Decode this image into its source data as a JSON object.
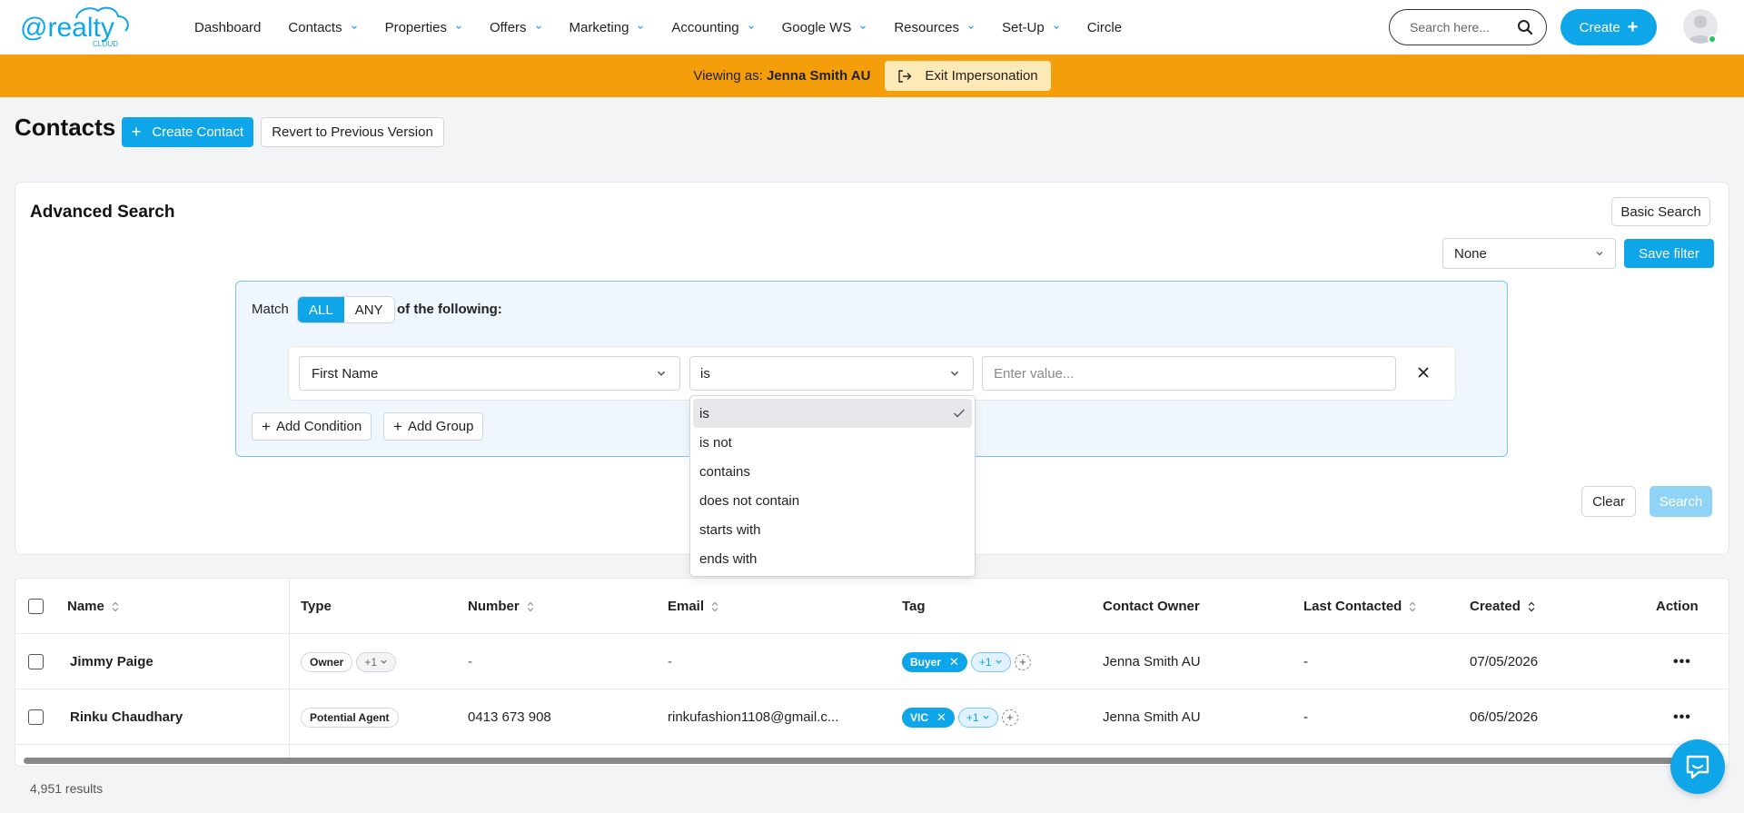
{
  "logo": {
    "brand_text": "@realty",
    "sub_text": "CLOUD"
  },
  "nav": {
    "items": [
      {
        "label": "Dashboard",
        "dropdown": false
      },
      {
        "label": "Contacts",
        "dropdown": true
      },
      {
        "label": "Properties",
        "dropdown": true
      },
      {
        "label": "Offers",
        "dropdown": true
      },
      {
        "label": "Marketing",
        "dropdown": true
      },
      {
        "label": "Accounting",
        "dropdown": true
      },
      {
        "label": "Google WS",
        "dropdown": true
      },
      {
        "label": "Resources",
        "dropdown": true
      },
      {
        "label": "Set-Up",
        "dropdown": true
      },
      {
        "label": "Circle",
        "dropdown": false
      }
    ],
    "search_placeholder": "Search here...",
    "create_label": "Create"
  },
  "impersonation": {
    "prefix": "Viewing as:",
    "user": "Jenna Smith AU",
    "exit_label": "Exit Impersonation"
  },
  "page": {
    "title": "Contacts",
    "create_contact_label": "Create Contact",
    "revert_label": "Revert to Previous Version"
  },
  "advanced_search": {
    "title": "Advanced Search",
    "basic_search_label": "Basic Search",
    "saved_filter_value": "None",
    "save_filter_label": "Save filter",
    "match_label": "Match",
    "match_options": [
      "ALL",
      "ANY"
    ],
    "match_selected": "ALL",
    "of_following": "of the following:",
    "condition": {
      "field": "First Name",
      "operator": "is",
      "value_placeholder": "Enter value..."
    },
    "add_condition_label": "Add Condition",
    "add_group_label": "Add Group",
    "clear_label": "Clear",
    "search_label": "Search",
    "operator_options": [
      "is",
      "is not",
      "contains",
      "does not contain",
      "starts with",
      "ends with"
    ]
  },
  "table": {
    "columns": [
      "Name",
      "Type",
      "Number",
      "Email",
      "Tag",
      "Contact Owner",
      "Last Contacted",
      "Created",
      "Action"
    ],
    "rows": [
      {
        "name": "Jimmy Paige",
        "type": "Owner",
        "type_more": "+1",
        "number": "-",
        "email": "-",
        "tag": "Buyer",
        "tag_more": "+1",
        "owner": "Jenna Smith AU",
        "last_contacted": "-",
        "created": "07/05/2026",
        "action": "•••"
      },
      {
        "name": "Rinku Chaudhary",
        "type": "Potential Agent",
        "type_more": "",
        "number": "0413 673 908",
        "email": "rinkufashion1108@gmail.c...",
        "tag": "VIC",
        "tag_more": "+1",
        "owner": "Jenna Smith AU",
        "last_contacted": "-",
        "created": "06/05/2026",
        "action": "•••"
      }
    ],
    "results_text": "4,951 results"
  },
  "colors": {
    "accent": "#0ea5e9",
    "impersonation_bar": "#f59e0b",
    "online": "#22c55e"
  }
}
